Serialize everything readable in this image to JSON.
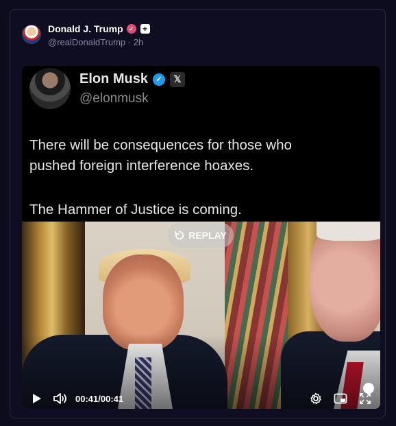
{
  "post": {
    "author_name": "Donald J. Trump",
    "author_handle": "@realDonaldTrump",
    "separator": "·",
    "time_ago": "2h",
    "verified_icon": "verified-badge-icon",
    "plus_badge": "+"
  },
  "embedded_tweet": {
    "name": "Elon Musk",
    "handle": "@elonmusk",
    "line1": "There will be consequences for those who",
    "line2": "pushed foreign interference hoaxes.",
    "line3": "The Hammer of Justice is coming.",
    "x_logo": "𝕏"
  },
  "video": {
    "replay_label": "REPLAY",
    "time_current": "00:41",
    "time_total": "00:41",
    "time_separator": "/",
    "progress": 1.0
  },
  "colors": {
    "background": "#0d0b1e",
    "card": "#0f0d22",
    "muted_text": "#8a87a6",
    "badge_pink": "#e24c72",
    "twitter_blue": "#1d9bf0"
  }
}
